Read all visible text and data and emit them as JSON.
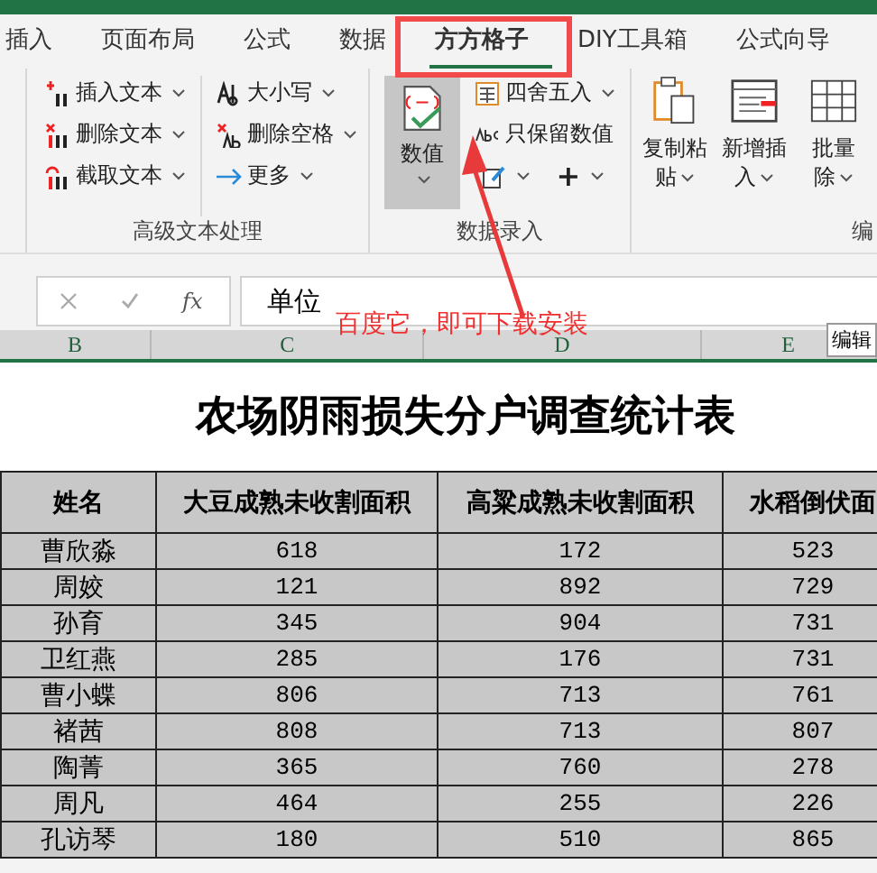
{
  "tabs": [
    {
      "label": "插入",
      "selected": false
    },
    {
      "label": "页面布局",
      "selected": false
    },
    {
      "label": "公式",
      "selected": false
    },
    {
      "label": "数据",
      "selected": false
    },
    {
      "label": "方方格子",
      "selected": true
    },
    {
      "label": "DIY工具箱",
      "selected": false
    },
    {
      "label": "公式向导",
      "selected": false
    }
  ],
  "text_group": {
    "label": "高级文本处理",
    "columns": [
      [
        {
          "label": "插入文本",
          "kind": "insert"
        },
        {
          "label": "删除文本",
          "kind": "delete"
        },
        {
          "label": "截取文本",
          "kind": "cut"
        }
      ],
      [
        {
          "label": "大小写",
          "kind": "case"
        },
        {
          "label": "删除空格",
          "kind": "space"
        },
        {
          "label": "更多",
          "kind": "more"
        }
      ]
    ]
  },
  "entry_group": {
    "label": "数据录入",
    "big_button": {
      "label": "数值",
      "selected": true
    },
    "items": [
      {
        "label": "四舍五入",
        "kind": "round"
      },
      {
        "label": "只保留数值",
        "kind": "keep"
      }
    ],
    "icon_buttons": [
      {
        "kind": "pen"
      },
      {
        "kind": "plus",
        "label": "+"
      }
    ]
  },
  "edit_group": {
    "label": "编",
    "buttons": [
      {
        "lines": [
          "复制粘",
          "贴"
        ],
        "kind": "paste"
      },
      {
        "lines": [
          "新增插",
          "入"
        ],
        "kind": "insert"
      },
      {
        "lines": [
          "批量",
          "除"
        ],
        "kind": "grid"
      }
    ]
  },
  "formula_bar": {
    "function_label": "fx",
    "value": "单位"
  },
  "tooltip": "编辑",
  "column_headers": [
    "B",
    "C",
    "D",
    "E"
  ],
  "annotation": "百度它，即可下载安装",
  "sheet_title": "农场阴雨损失分户调查统计表",
  "table": {
    "columns": [
      "姓名",
      "大豆成熟未收割面积",
      "高粱成熟未收割面积",
      "水稻倒伏面"
    ],
    "rows": [
      [
        "曹欣淼",
        "618",
        "172",
        "523"
      ],
      [
        "周姣",
        "121",
        "892",
        "729"
      ],
      [
        "孙育",
        "345",
        "904",
        "731"
      ],
      [
        "卫红燕",
        "285",
        "176",
        "731"
      ],
      [
        "曹小蝶",
        "806",
        "713",
        "761"
      ],
      [
        "褚茜",
        "808",
        "713",
        "807"
      ],
      [
        "陶菁",
        "365",
        "760",
        "278"
      ],
      [
        "周凡",
        "464",
        "255",
        "226"
      ],
      [
        "孔访琴",
        "180",
        "510",
        "865"
      ]
    ]
  }
}
